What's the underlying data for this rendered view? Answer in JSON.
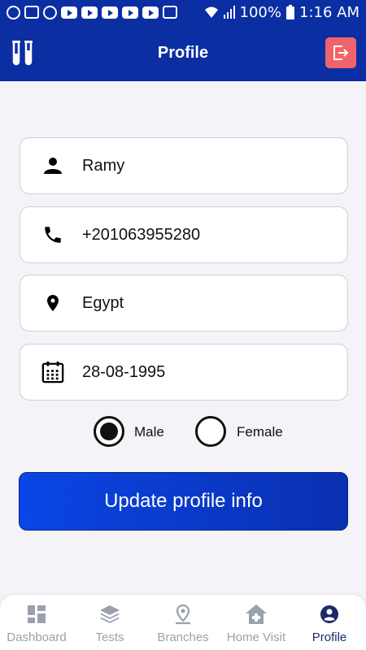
{
  "status_bar": {
    "battery": "100%",
    "time": "1:16 AM"
  },
  "app_bar": {
    "title": "Profile"
  },
  "profile": {
    "name": "Ramy",
    "phone": "+201063955280",
    "country": "Egypt",
    "birth_date": "28-08-1995"
  },
  "gender": {
    "options": [
      "Male",
      "Female"
    ],
    "selected": "Male"
  },
  "update_button": {
    "label": "Update profile info"
  },
  "bottom_nav": {
    "items": [
      {
        "label": "Dashboard",
        "icon": "dashboard-icon"
      },
      {
        "label": "Tests",
        "icon": "layers-icon"
      },
      {
        "label": "Branches",
        "icon": "location-pin-icon"
      },
      {
        "label": "Home Visit",
        "icon": "home-medical-icon"
      },
      {
        "label": "Profile",
        "icon": "account-circle-icon"
      }
    ],
    "active": "Profile"
  },
  "colors": {
    "primary": "#0b2ea3",
    "logout": "#f0646a",
    "nav_active": "#1c2a6a",
    "nav_inactive": "#9aa1ad"
  }
}
